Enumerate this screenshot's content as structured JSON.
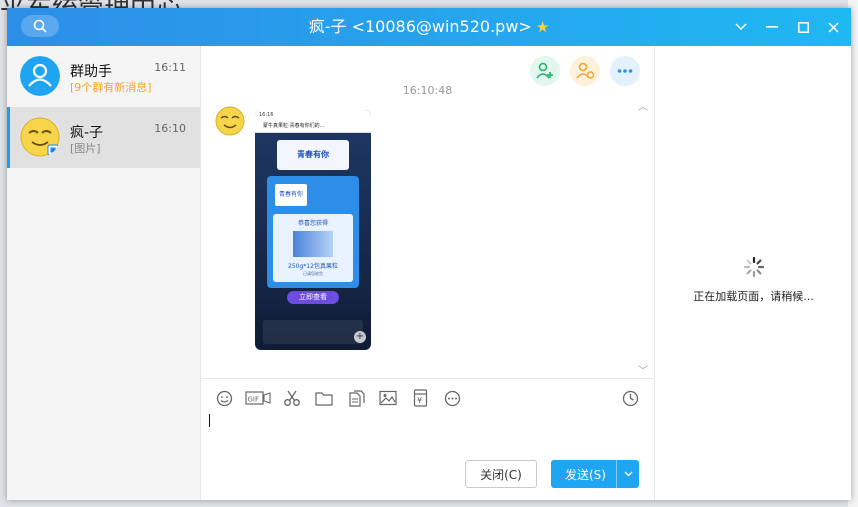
{
  "background": {
    "title_fragment": "平东统管理中心"
  },
  "window": {
    "title": "疯-子 <10086@win520.pw>",
    "title_star": "★",
    "controls": {
      "dropdown": "⌵",
      "minimize": "—",
      "maximize": "☐",
      "close": "✕"
    }
  },
  "sidebar": {
    "contacts": [
      {
        "name": "群助手",
        "time": "16:11",
        "subtitle": "[9个群有新消息]"
      },
      {
        "name": "疯-子",
        "time": "16:10",
        "subtitle": "[图片]"
      }
    ]
  },
  "chat": {
    "message_time": "16:10:48",
    "image": {
      "status_time": "16:16",
      "page_title": "蒙牛真果粒·青春有你们的...",
      "banner": "青春有你",
      "prize_title": "恭喜您获得",
      "prize_desc": "250g*12包真果粒",
      "prize_note": "已请您收货",
      "cta": "立即查看"
    },
    "toolbar": {
      "emoji": "emoji",
      "gif": "GIF",
      "scissors": "cut",
      "folder": "folder",
      "file": "file",
      "image": "image",
      "red_packet": "red-packet",
      "more": "more",
      "history": "history"
    },
    "buttons": {
      "close": "关闭(C)",
      "send": "发送(S)"
    }
  },
  "right_panel": {
    "loading_text": "正在加载页面，请稍候..."
  },
  "colors": {
    "titlebar_start": "#2d8ee8",
    "titlebar_end": "#1fb8f2",
    "send": "#1fa6f2",
    "accent": "#1d9bf0"
  }
}
